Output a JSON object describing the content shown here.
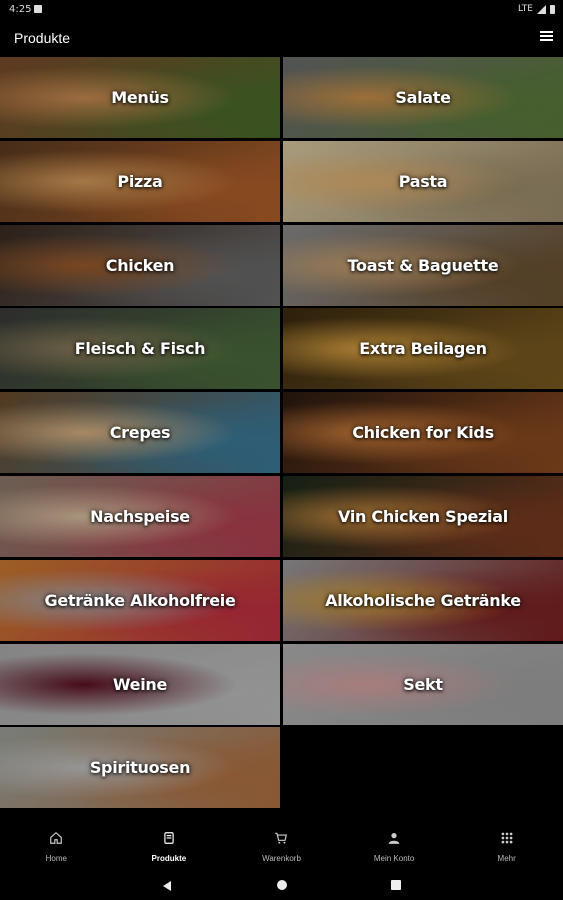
{
  "status_bar": {
    "time": "4:25",
    "network": "LTE"
  },
  "app_bar": {
    "title": "Produkte"
  },
  "tiles": [
    {
      "label": "Menüs",
      "colors": [
        "#7a4a2a",
        "#c98a52",
        "#4a6a2a"
      ]
    },
    {
      "label": "Salate",
      "colors": [
        "#6b6b6b",
        "#c88e4a",
        "#5a7a3a"
      ]
    },
    {
      "label": "Pizza",
      "colors": [
        "#5a3a20",
        "#d29a5a",
        "#b0602a"
      ]
    },
    {
      "label": "Pasta",
      "colors": [
        "#d8c8a0",
        "#e0b070",
        "#9a8a6a"
      ]
    },
    {
      "label": "Chicken",
      "colors": [
        "#3a2a20",
        "#9a5a2a",
        "#6a6a6a"
      ]
    },
    {
      "label": "Toast & Baguette",
      "colors": [
        "#8a8a8a",
        "#c8a070",
        "#6a5030"
      ]
    },
    {
      "label": "Fleisch & Fisch",
      "colors": [
        "#3a3a3a",
        "#8a7a5a",
        "#4a6a3a"
      ]
    },
    {
      "label": "Extra Beilagen",
      "colors": [
        "#3a2a10",
        "#d8a040",
        "#7a5a20"
      ]
    },
    {
      "label": "Crepes",
      "colors": [
        "#6a4a2a",
        "#d8b080",
        "#3a7a9a"
      ]
    },
    {
      "label": "Chicken for Kids",
      "colors": [
        "#2a1a10",
        "#c87a3a",
        "#8a4a20"
      ]
    },
    {
      "label": "Nachspeise",
      "colors": [
        "#8a7a6a",
        "#d8c0a0",
        "#b04050"
      ]
    },
    {
      "label": "Vin Chicken Spezial",
      "colors": [
        "#1a2a1a",
        "#c88a40",
        "#7a3a20"
      ]
    },
    {
      "label": "Getränke Alkoholfreie",
      "colors": [
        "#c87a30",
        "#aaaaaa",
        "#c03040"
      ]
    },
    {
      "label": "Alkoholische Getränke",
      "colors": [
        "#9a9a9a",
        "#d0a040",
        "#7a2020"
      ]
    },
    {
      "label": "Weine",
      "colors": [
        "#aaaaaa",
        "#5a1020",
        "#bbbbbb"
      ]
    },
    {
      "label": "Sekt",
      "colors": [
        "#b0b0b0",
        "#d8a0a0",
        "#a0a0a0"
      ]
    },
    {
      "label": "Spirituosen",
      "colors": [
        "#9aa09a",
        "#c0c0c0",
        "#b07040"
      ]
    }
  ],
  "bottom_nav": [
    {
      "label": "Home",
      "icon": "home-icon",
      "active": false
    },
    {
      "label": "Produkte",
      "icon": "menu-book-icon",
      "active": true
    },
    {
      "label": "Warenkorb",
      "icon": "cart-icon",
      "active": false
    },
    {
      "label": "Mein Konto",
      "icon": "person-icon",
      "active": false
    },
    {
      "label": "Mehr",
      "icon": "grid-icon",
      "active": false
    }
  ]
}
